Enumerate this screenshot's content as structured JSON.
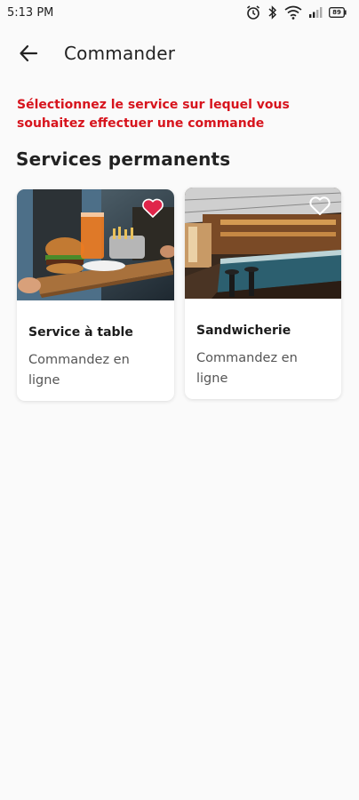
{
  "status_bar": {
    "time": "5:13 PM",
    "icons": [
      "alarm-icon",
      "bluetooth-icon",
      "wifi-icon",
      "signal-icon",
      "battery-icon"
    ],
    "battery": "89"
  },
  "app_bar": {
    "back_icon": "arrow-left-icon",
    "title": "Commander"
  },
  "prompt": "Sélectionnez le service sur lequel vous souhaitez effectuer une commande",
  "section": {
    "title": "Services permanents"
  },
  "services": [
    {
      "title": "Service à table",
      "description": "Commandez en ligne",
      "favorite": true
    },
    {
      "title": "Sandwicherie",
      "description": "Commandez en ligne",
      "favorite": false
    }
  ],
  "colors": {
    "accent": "#d7141d",
    "favorite_active": "#e0254a",
    "background": "#fafafa"
  }
}
